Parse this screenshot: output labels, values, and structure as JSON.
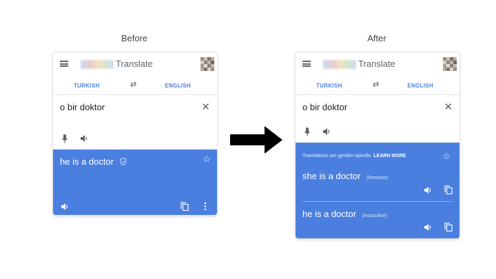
{
  "headings": {
    "before": "Before",
    "after": "After"
  },
  "app": {
    "title": "Translate",
    "source_lang": "TURKISH",
    "target_lang": "ENGLISH"
  },
  "before": {
    "input_text": "o bir doktor",
    "translation": "he is a doctor"
  },
  "after": {
    "input_text": "o bir doktor",
    "note_text": "Translations are gender-specific.",
    "note_link": "LEARN MORE",
    "translations": [
      {
        "text": "she is a doctor",
        "gender": "(feminine)"
      },
      {
        "text": "he is a doctor",
        "gender": "(masculine)"
      }
    ]
  },
  "colors": {
    "accent": "#4a7fe0",
    "arrow": "#000000",
    "icon_gray": "#5f6368"
  },
  "icons": [
    "menu-icon",
    "swap-icon",
    "close-icon",
    "mic-icon",
    "speaker-icon",
    "shield-check-icon",
    "star-icon",
    "copy-icon",
    "more-vert-icon"
  ]
}
